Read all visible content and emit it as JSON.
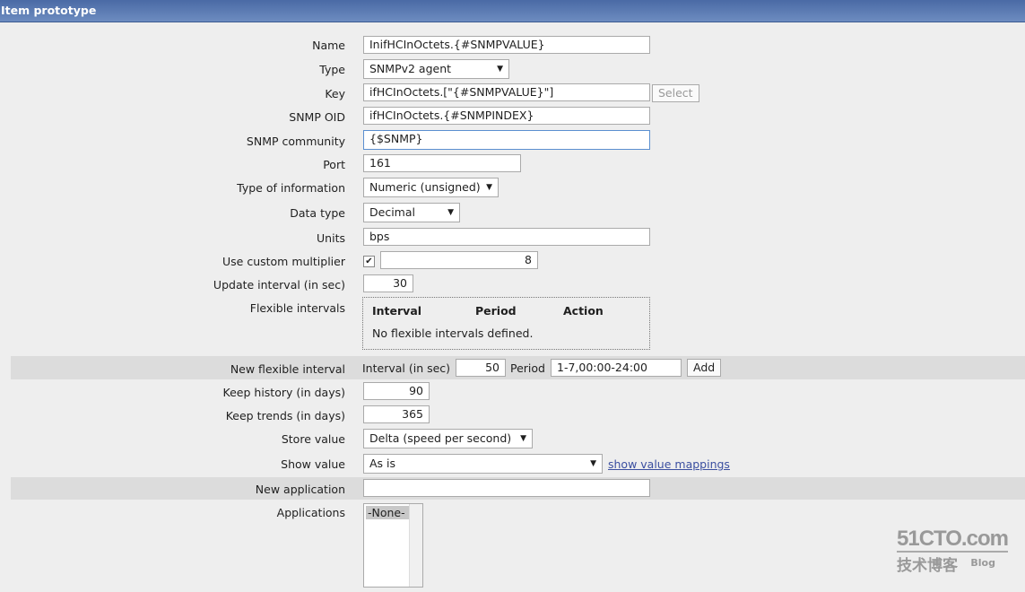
{
  "header": {
    "title": "Item prototype"
  },
  "form": {
    "name": {
      "label": "Name",
      "value": "InifHCInOctets.{#SNMPVALUE}"
    },
    "type": {
      "label": "Type",
      "value": "SNMPv2 agent"
    },
    "key": {
      "label": "Key",
      "value": "ifHCInOctets.[\"{#SNMPVALUE}\"]",
      "select": "Select"
    },
    "snmp_oid": {
      "label": "SNMP OID",
      "value": "ifHCInOctets.{#SNMPINDEX}"
    },
    "snmp_community": {
      "label": "SNMP community",
      "value": "{$SNMP}"
    },
    "port": {
      "label": "Port",
      "value": "161"
    },
    "type_info": {
      "label": "Type of information",
      "value": "Numeric (unsigned)"
    },
    "data_type": {
      "label": "Data type",
      "value": "Decimal"
    },
    "units": {
      "label": "Units",
      "value": "bps"
    },
    "multiplier": {
      "label": "Use custom multiplier",
      "checked": true,
      "value": "8"
    },
    "update": {
      "label": "Update interval (in sec)",
      "value": "30"
    },
    "flexible": {
      "label": "Flexible intervals",
      "cols": [
        "Interval",
        "Period",
        "Action"
      ],
      "empty": "No flexible intervals defined."
    },
    "new_flexible": {
      "label": "New flexible interval",
      "interval_label": "Interval (in sec)",
      "interval": "50",
      "period_label": "Period",
      "period": "1-7,00:00-24:00",
      "add": "Add"
    },
    "history": {
      "label": "Keep history (in days)",
      "value": "90"
    },
    "trends": {
      "label": "Keep trends (in days)",
      "value": "365"
    },
    "store": {
      "label": "Store value",
      "value": "Delta (speed per second)"
    },
    "show": {
      "label": "Show value",
      "value": "As is",
      "link": "show value mappings"
    },
    "new_app": {
      "label": "New application",
      "value": ""
    },
    "apps": {
      "label": "Applications",
      "options": [
        "-None-"
      ]
    }
  },
  "watermark": {
    "text": "51CTO.com",
    "sub": "技术博客",
    "blog": "Blog"
  }
}
